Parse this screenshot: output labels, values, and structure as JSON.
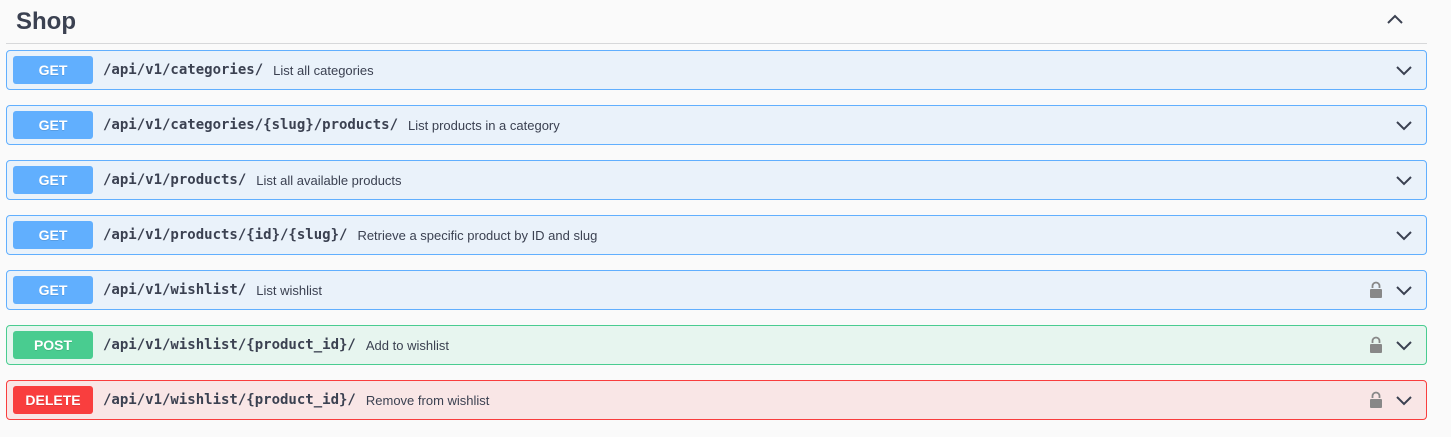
{
  "section": {
    "title": "Shop"
  },
  "operations": [
    {
      "method": "GET",
      "path": "/api/v1/categories/",
      "summary": "List all categories",
      "locked": false
    },
    {
      "method": "GET",
      "path": "/api/v1/categories/{slug}/products/",
      "summary": "List products in a category",
      "locked": false
    },
    {
      "method": "GET",
      "path": "/api/v1/products/",
      "summary": "List all available products",
      "locked": false
    },
    {
      "method": "GET",
      "path": "/api/v1/products/{id}/{slug}/",
      "summary": "Retrieve a specific product by ID and slug",
      "locked": false
    },
    {
      "method": "GET",
      "path": "/api/v1/wishlist/",
      "summary": "List wishlist",
      "locked": true
    },
    {
      "method": "POST",
      "path": "/api/v1/wishlist/{product_id}/",
      "summary": "Add to wishlist",
      "locked": true
    },
    {
      "method": "DELETE",
      "path": "/api/v1/wishlist/{product_id}/",
      "summary": "Remove from wishlist",
      "locked": true
    }
  ],
  "icons": {
    "collapse": "chevron-up-icon",
    "expand": "chevron-down-icon",
    "lock": "lock-icon"
  },
  "colors": {
    "get": "#61affe",
    "post": "#49cc90",
    "delete": "#f93e3e"
  }
}
